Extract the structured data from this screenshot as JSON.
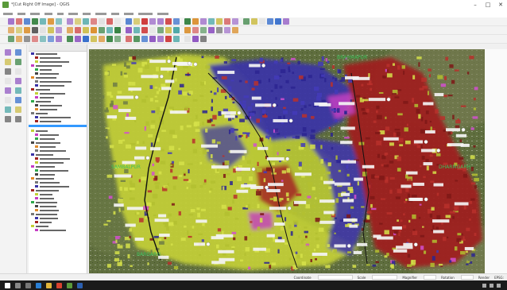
{
  "window": {
    "title": "*[Cut Right Off Image] - QGIS"
  },
  "map": {
    "district_labels": [
      {
        "text": "BRAHMAPUR",
        "color": "#2ea84a"
      },
      {
        "text": "SAMBALPUR",
        "color": "#2ea84a"
      },
      {
        "text": "BARGARH",
        "color": "#2ea84a"
      },
      {
        "text": "DHARMGARH",
        "color": "#2ea84a"
      }
    ],
    "zones": [
      {
        "name": "plain",
        "color": "#c9d63a"
      },
      {
        "name": "blue",
        "color": "#3b35a8"
      },
      {
        "name": "red",
        "color": "#a1221f"
      },
      {
        "name": "magenta",
        "color": "#c53bc4"
      }
    ]
  },
  "status": {
    "coordinate_label": "Coordinate",
    "coordinate_value": "",
    "scale_label": "Scale",
    "scale_value": "",
    "magnifier_label": "Magnifier",
    "rotation_label": "Rotation",
    "render_label": "Render",
    "epsg": "EPSG:"
  },
  "taskbar": {
    "time": "",
    "date": ""
  }
}
